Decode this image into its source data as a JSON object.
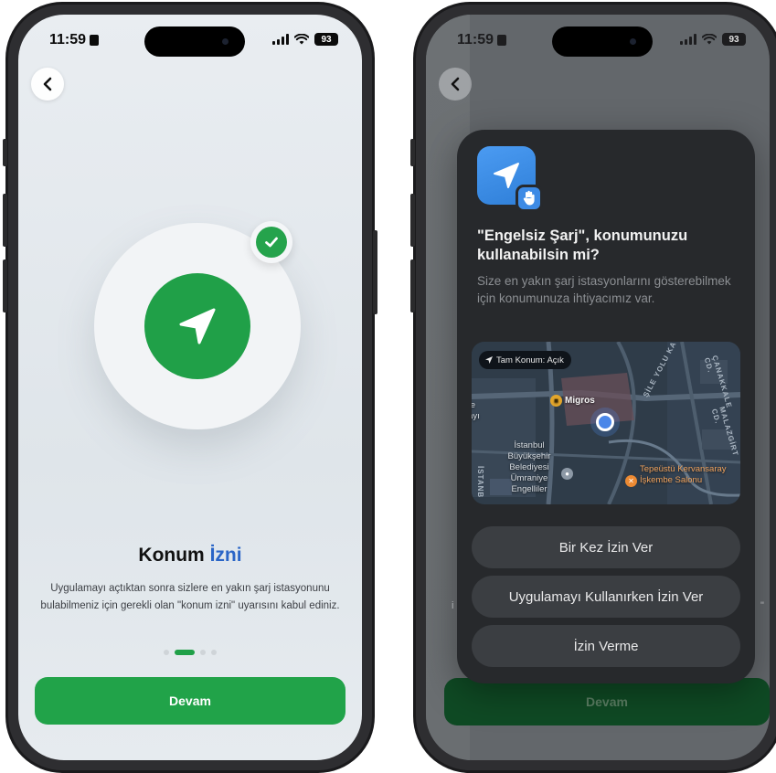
{
  "status_bar": {
    "time": "11:59",
    "battery": "93"
  },
  "onboarding": {
    "title_part1": "Konum",
    "title_part2": "İzni",
    "description": "Uygulamayı açtıktan sonra sizlere en yakın şarj istasyonunu bulabilmeniz için gerekli olan \"konum izni\" uyarısını kabul ediniz.",
    "continue_label": "Devam",
    "page_indicator": {
      "total": 4,
      "active": 2
    }
  },
  "permission_dialog": {
    "title": "\"Engelsiz Şarj\", konumunuzu kullanabilsin mi?",
    "description": "Size en yakın şarj istasyonlarını gösterebilmek için konumunuza ihtiyacımız var.",
    "map": {
      "precise_toggle": "Tam Konum: Açık",
      "pins": {
        "migros": "Migros",
        "belediye": "İstanbul Büyükşehir Belediyesi Ümraniye Engelliler",
        "kervansaray": "Tepeüstü Kervansaray İşkembe Salonu"
      },
      "partial_left": "ye\nlayı",
      "roads": {
        "kavsagi": "ŞİLE YOLU KAVŞAĞI",
        "canakkale": "ÇANAKKALE CD.",
        "malazgirt": "MALAZGİRT CD.",
        "istanb": "İSTANB"
      }
    },
    "options": [
      "Bir Kez İzin Ver",
      "Uygulamayı Kullanırken İzin Ver",
      "İzin Verme"
    ]
  },
  "background_continue_label": "Devam",
  "colors": {
    "primary_green": "#21a349",
    "accent_blue": "#2a65c7",
    "dialog_bg": "#27292c"
  }
}
